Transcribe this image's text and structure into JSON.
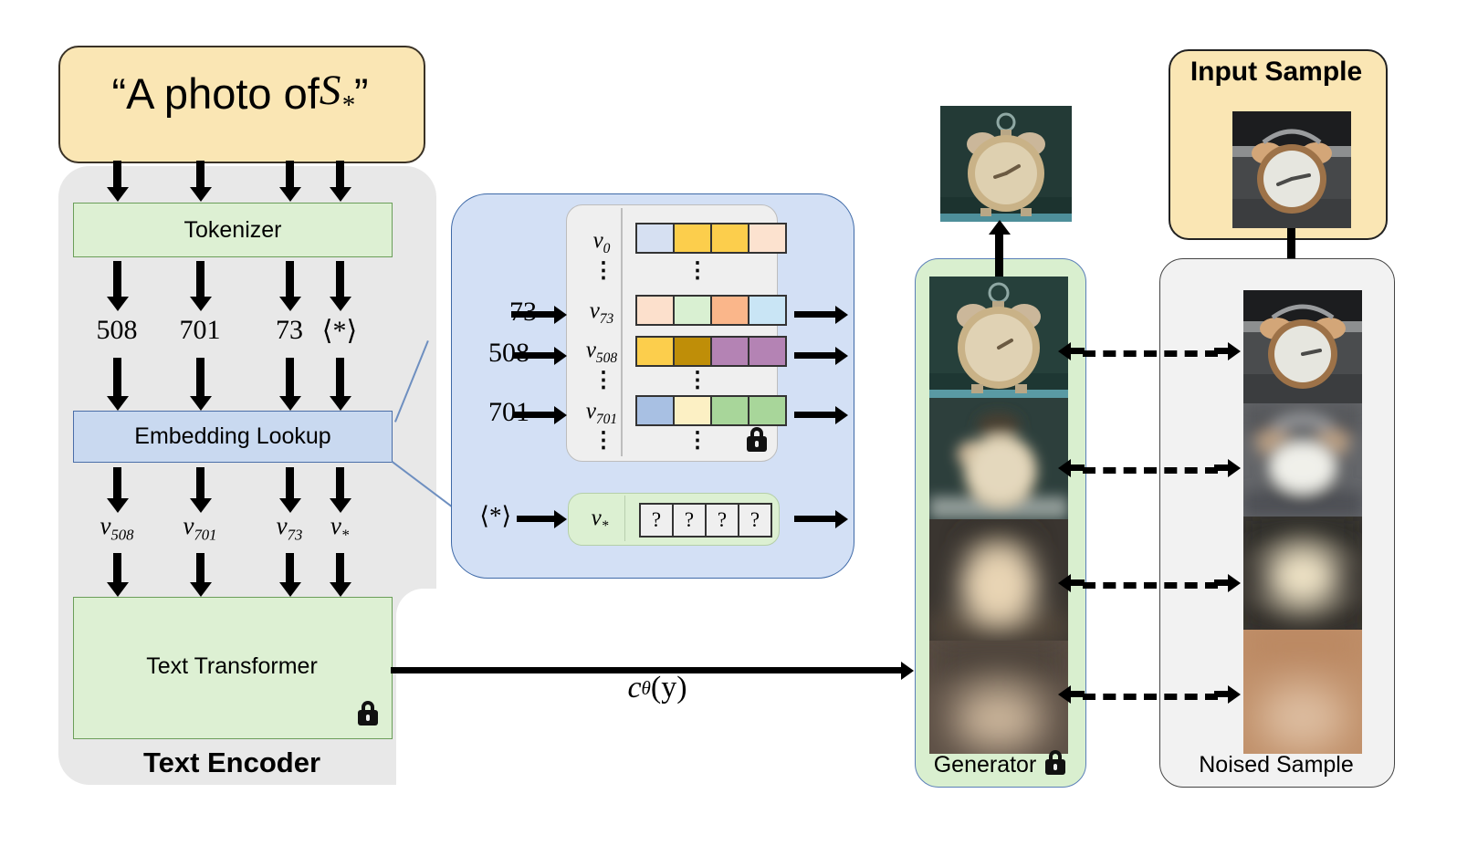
{
  "prompt": {
    "text_pre": "“A photo of ",
    "symbol": "S",
    "symbol_sub": "*",
    "text_post": "”"
  },
  "text_encoder": {
    "caption": "Text Encoder",
    "tokenizer_label": "Tokenizer",
    "embedding_lookup_label": "Embedding Lookup",
    "transformer_label": "Text Transformer",
    "lock_icon": "lock-icon",
    "token_ids": [
      "508",
      "701",
      "73",
      "⟨*⟩"
    ],
    "embeddings": [
      "v",
      "v",
      "v",
      "v"
    ],
    "embedding_subs": [
      "508",
      "701",
      "73",
      "*"
    ]
  },
  "detail": {
    "inputs": [
      "73",
      "508",
      "701"
    ],
    "star_input": "⟨*⟩",
    "rows": [
      {
        "label": "v",
        "sub": "0",
        "colors": [
          "#d6e0f2",
          "#fcce4c",
          "#fcce4c",
          "#fce2cf"
        ]
      },
      {
        "label": "v",
        "sub": "73",
        "colors": [
          "#fce0cc",
          "#d9f0d2",
          "#fab68a",
          "#c9e5f5"
        ]
      },
      {
        "label": "v",
        "sub": "508",
        "colors": [
          "#fcce4c",
          "#bf8e08",
          "#b483b4",
          "#b483b4"
        ]
      },
      {
        "label": "v",
        "sub": "701",
        "colors": [
          "#a8c0e3",
          "#fcf0c4",
          "#a8d69a",
          "#a8d69a"
        ]
      }
    ],
    "vertical_dots": "⋮",
    "star_row": {
      "label": "v",
      "sub": "*",
      "cells": [
        "?",
        "?",
        "?",
        "?"
      ]
    },
    "lock_icon": "lock-icon"
  },
  "conditioning_label": {
    "c": "c",
    "theta": "θ",
    "arg": "(y)"
  },
  "generator": {
    "caption": "Generator",
    "lock_icon": "lock-icon"
  },
  "noised": {
    "caption": "Noised Sample"
  },
  "input_sample": {
    "title": "Input Sample"
  },
  "colors": {
    "prompt_bg": "#fae6b4",
    "encoder_bg": "#e8e8e8",
    "green_box": "#ddf0d3",
    "blue_box": "#c9d9f0",
    "detail_bg": "#d3e0f5",
    "generator_bg": "#d9efcf",
    "noised_bg": "#f2f2f2"
  }
}
